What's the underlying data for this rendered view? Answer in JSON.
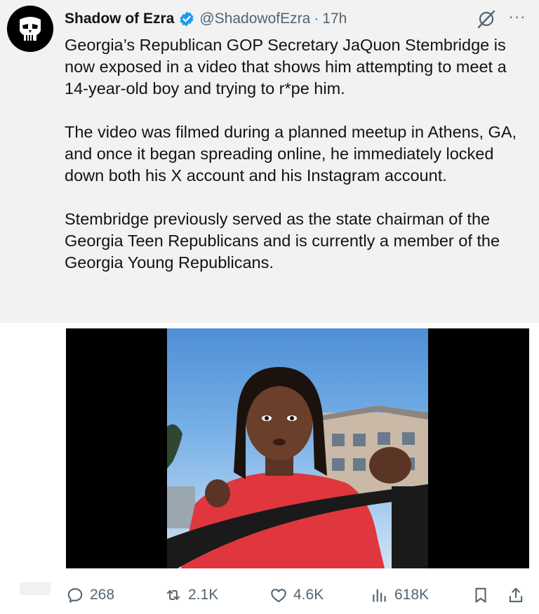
{
  "post": {
    "author_name": "Shadow of Ezra",
    "handle": "@ShadowofEzra",
    "separator": "·",
    "time": "17h",
    "more_label": "···",
    "paragraphs": [
      "Georgia’s Republican GOP Secretary JaQuon Stembridge is now exposed in a video that shows him attempting to meet a 14-year-old boy and trying to r*pe him.",
      "The video was filmed during a planned meetup in Athens, GA, and once it began spreading online, he immediately locked down both his X account and his Instagram account.",
      "Stembridge previously served as the state chairman of the Georgia Teen Republicans and is currently a member of the Georgia Young Republicans."
    ]
  },
  "actions": {
    "replies": "268",
    "reposts": "2.1K",
    "likes": "4.6K",
    "views": "618K"
  },
  "icons": {
    "avatar": "punisher-skull-avatar",
    "verified": "verified-badge-icon",
    "grok": "grok-icon",
    "reply": "reply-icon",
    "repost": "repost-icon",
    "like": "heart-icon",
    "views": "views-icon",
    "bookmark": "bookmark-icon",
    "share": "share-icon"
  },
  "colors": {
    "background": "#f2f2f2",
    "text": "#0f1419",
    "secondary": "#536471",
    "verified": "#1d9bf0"
  }
}
